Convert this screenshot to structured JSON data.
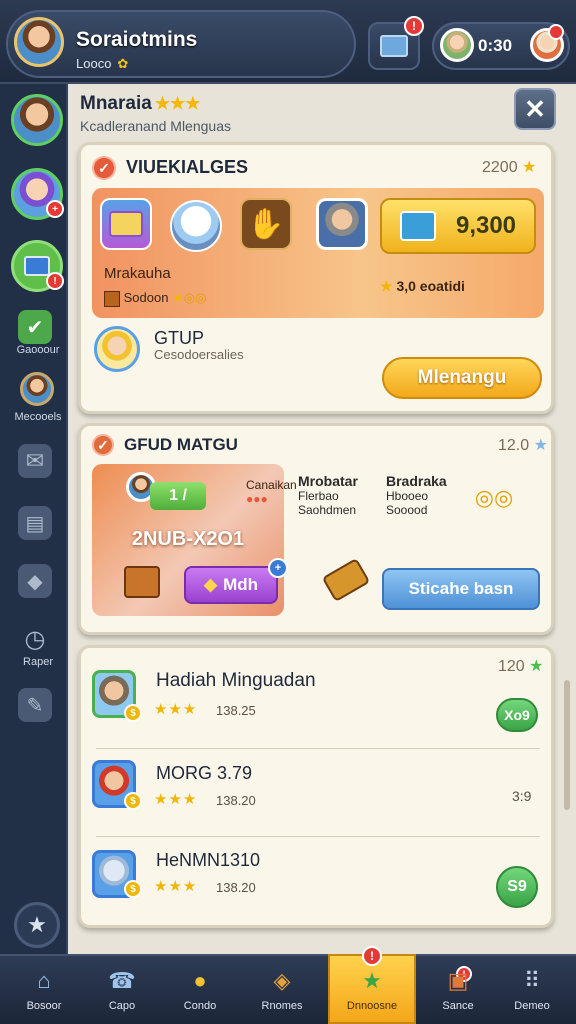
{
  "header": {
    "player_name": "Soraiotmins",
    "player_sub": "Looco",
    "player_sub_badge": "✿",
    "mail_badge": "!",
    "friend_count": "0:30"
  },
  "sidebar": {
    "items": [
      {
        "label": "Gaooour"
      },
      {
        "label": "Mecooels"
      },
      {
        "label": "Raper"
      }
    ]
  },
  "panel": {
    "title": "Mnaraia",
    "title_stars": "★★★",
    "subtitle": "Kcadleranand Mlenguas",
    "close_label": "✕"
  },
  "card1": {
    "header": "VIUEKIALGES",
    "points": "2200",
    "price": "9,300",
    "item_label": "Mrakauha",
    "item_sub": "Sodoon",
    "amount": "3,0 eoatidi",
    "group_title": "GTUP",
    "group_sub": "Cesodoersalies",
    "button": "Mlenangu"
  },
  "card2": {
    "header": "GFUD MATGU",
    "points": "12.0",
    "plus_label": "1 /",
    "green_label": "Canaikan",
    "code": "2NUB-X2O1",
    "mini_button": "Mdh",
    "col1_title": "Mrobatar",
    "col1_lines": [
      "Flerbao",
      "Saohdmen"
    ],
    "col2_title": "Bradraka",
    "col2_lines": [
      "Hbooeo",
      "Sooood"
    ],
    "button": "Sticahe basn"
  },
  "card3": {
    "header": "Hadiah Minguadan",
    "points": "120",
    "rows": [
      {
        "name": "",
        "stars": "★★★",
        "time": "138.25",
        "action": "Xo9"
      },
      {
        "name": "MORG 3.79",
        "stars": "★★★",
        "time": "138.20",
        "action": "3:9"
      },
      {
        "name": "HeNMN1310",
        "stars": "★★★",
        "time": "138.20",
        "action": "S9"
      }
    ]
  },
  "bottom_nav": {
    "items": [
      {
        "label": "Bosoor",
        "icon": "home-icon"
      },
      {
        "label": "Capo",
        "icon": "chat-icon"
      },
      {
        "label": "Condo",
        "icon": "coin-icon"
      },
      {
        "label": "Rnomes",
        "icon": "shield-icon"
      },
      {
        "label": "Dnnoosne",
        "icon": "star-icon"
      },
      {
        "label": "Sance",
        "icon": "gift-icon"
      },
      {
        "label": "Demeo",
        "icon": "grid-icon"
      }
    ]
  },
  "colors": {
    "accent_orange": "#f3a81a",
    "accent_blue": "#4f91d6",
    "accent_green": "#3aa447",
    "badge_red": "#e53935"
  }
}
